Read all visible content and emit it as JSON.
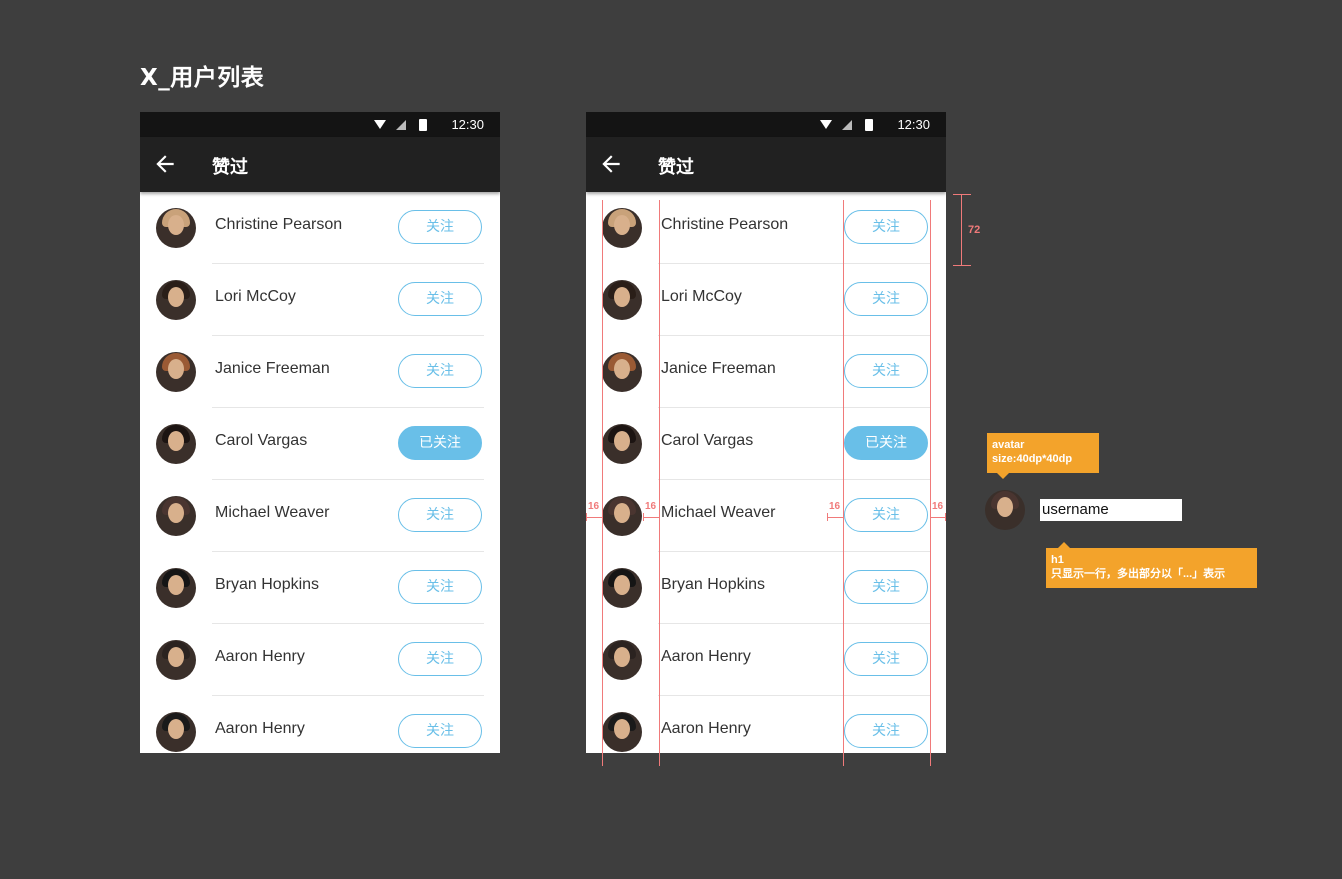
{
  "page_title": "X_用户列表",
  "status_bar": {
    "time": "12:30"
  },
  "app_bar": {
    "title": "赞过"
  },
  "users": [
    {
      "name": "Christine Pearson",
      "follow_label": "关注",
      "followed": false,
      "hair": "#c9a27a"
    },
    {
      "name": "Lori McCoy",
      "follow_label": "关注",
      "followed": false,
      "hair": "#2a1e18"
    },
    {
      "name": "Janice Freeman",
      "follow_label": "关注",
      "followed": false,
      "hair": "#9a5a34"
    },
    {
      "name": "Carol Vargas",
      "follow_label": "已关注",
      "followed": true,
      "hair": "#1c1412"
    },
    {
      "name": "Michael Weaver",
      "follow_label": "关注",
      "followed": false,
      "hair": "#4a3530"
    },
    {
      "name": "Bryan Hopkins",
      "follow_label": "关注",
      "followed": false,
      "hair": "#151515"
    },
    {
      "name": "Aaron Henry",
      "follow_label": "关注",
      "followed": false,
      "hair": "#2b2320"
    },
    {
      "name": "Aaron Henry",
      "follow_label": "关注",
      "followed": false,
      "hair": "#1a1a1a"
    }
  ],
  "spec": {
    "row_height": "72",
    "margin_left": "16",
    "margin_gap": "16",
    "margin_btn": "16",
    "margin_right": "16",
    "avatar_note_title": "avatar",
    "avatar_note_body": "size:40dp*40dp",
    "username_sample": "username",
    "h1_note_title": "h1",
    "h1_note_body": "只显示一行，多出部分以「...」表示"
  },
  "colors": {
    "accent": "#69bfe8",
    "annotation": "#f3a32b",
    "guide": "#f07a7a"
  }
}
